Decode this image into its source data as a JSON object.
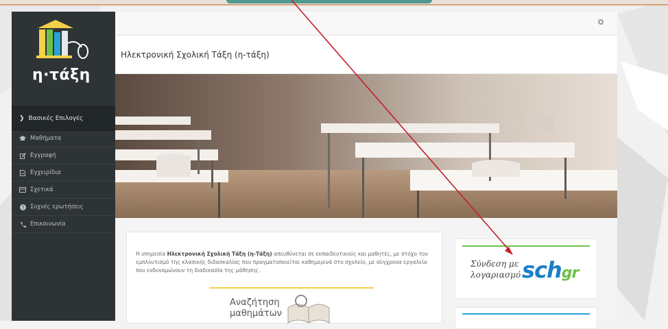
{
  "app": {
    "logo_text": "η·τάξη",
    "page_title": "Ηλεκτρονική Σχολική Τάξη (η-τάξη)"
  },
  "sidebar": {
    "section_label": "Βασικές Επιλογές",
    "items": [
      {
        "label": "Μαθήματα",
        "icon": "graduation-cap-icon"
      },
      {
        "label": "Εγγραφή",
        "icon": "edit-icon"
      },
      {
        "label": "Εγχειρίδια",
        "icon": "file-icon"
      },
      {
        "label": "Σχετικά",
        "icon": "card-icon"
      },
      {
        "label": "Συχνές ερωτήσεις",
        "icon": "question-circle-icon"
      },
      {
        "label": "Επικοινωνία",
        "icon": "phone-icon"
      }
    ]
  },
  "intro": {
    "before": "Η υπηρεσία ",
    "bold": "Ηλεκτρονική Σχολική Τάξη (η-Τάξη)",
    "after": " απευθύνεται σε εκπαιδευτικούς και μαθητές, με στόχο τον εμπλουτισμό της κλασικής διδασκαλίας που πραγματοποιείται καθημερινά στο σχολείο, με σύγχρονα εργαλεία που ενδυναμώνουν τη διαδικασία της μάθησης."
  },
  "search_courses": {
    "line1": "Αναζήτηση",
    "line2": "μαθημάτων"
  },
  "login": {
    "line1": "Σύνδεση με",
    "line2": "λογαριασμό",
    "brand": "sch",
    "brand_suffix": "gr"
  },
  "colors": {
    "sidebar_bg": "#2e3336",
    "accent_green": "#6cc04a",
    "accent_blue": "#1a7fc6",
    "arrow_red": "#c0202a"
  }
}
